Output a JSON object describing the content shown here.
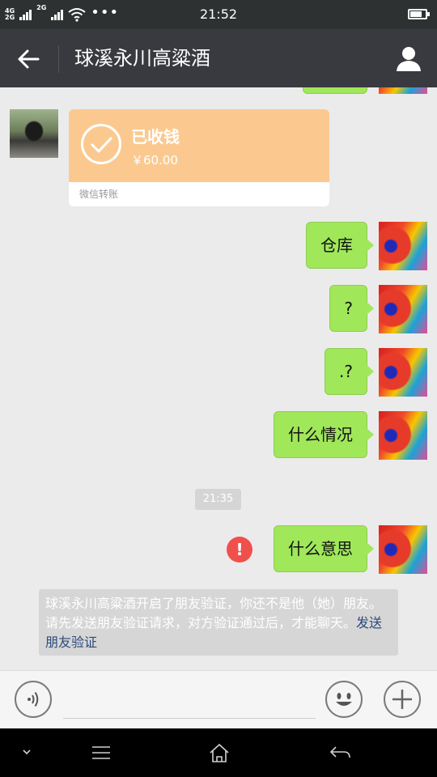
{
  "status_bar": {
    "network_top": "4G",
    "network_bottom": "2G",
    "network_mid": "2G",
    "dots": "•••",
    "time": "21:52",
    "battery_level": 0.8
  },
  "header": {
    "title": "球溪永川高粱酒"
  },
  "messages": {
    "transfer": {
      "title": "已收钱",
      "amount": "￥60.00",
      "source": "微信转账"
    },
    "sent": [
      "仓库",
      "?",
      ".?",
      "什么情况"
    ],
    "timestamp": "21:35",
    "failed_message": "什么意思",
    "error_mark": "!"
  },
  "system_notice": {
    "text": "球溪永川高粱酒开启了朋友验证，你还不是他（她）朋友。请先发送朋友验证请求，对方验证通过后，才能聊天。",
    "link": "发送朋友验证"
  },
  "icons": {
    "back": "arrow-left-icon",
    "contact": "person-icon",
    "voice": "voice-icon",
    "emoji": "smiley-icon",
    "more": "plus-icon",
    "check": "check-icon",
    "nav_down": "chevron-down-icon",
    "nav_menu": "menu-icon",
    "nav_home": "home-icon",
    "nav_return": "return-icon"
  },
  "colors": {
    "header_bg": "#393a3f",
    "chat_bg": "#ebebeb",
    "sent_bubble": "#a0e75a",
    "transfer_bg": "#fbc98f",
    "error": "#f0504c",
    "link": "#2b4a7a"
  }
}
